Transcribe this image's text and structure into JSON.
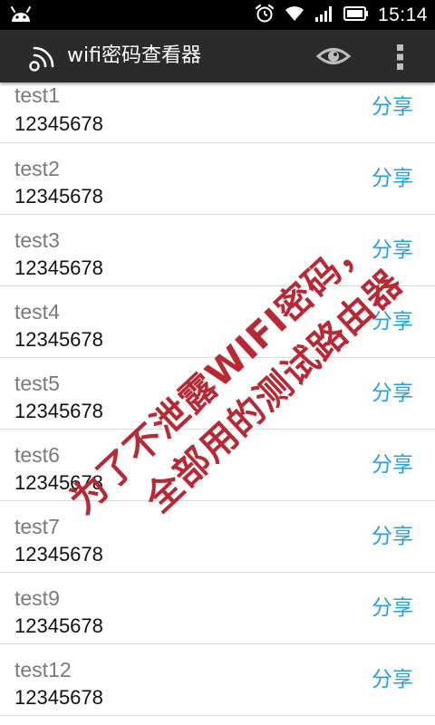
{
  "status_bar": {
    "time": "15:14",
    "icons": [
      "android-icon",
      "alarm-icon",
      "wifi-icon",
      "signal-icon",
      "battery-icon"
    ]
  },
  "action_bar": {
    "title": "wifi密码查看器",
    "icons": [
      "wifi-app-icon",
      "eye-icon",
      "overflow-menu-icon"
    ]
  },
  "list": {
    "share_label": "分享",
    "items": [
      {
        "ssid": "test1",
        "password": "12345678"
      },
      {
        "ssid": "test2",
        "password": "12345678"
      },
      {
        "ssid": "test3",
        "password": "12345678"
      },
      {
        "ssid": "test4",
        "password": "12345678"
      },
      {
        "ssid": "test5",
        "password": "12345678"
      },
      {
        "ssid": "test6",
        "password": "12345678"
      },
      {
        "ssid": "test7",
        "password": "12345678"
      },
      {
        "ssid": "test9",
        "password": "12345678"
      },
      {
        "ssid": "test12",
        "password": "12345678"
      }
    ]
  },
  "watermark": {
    "line1": "为了不泄露WIFI密码，",
    "line2": "全部用的测试路由器"
  },
  "colors": {
    "status_bar_bg": "#000000",
    "action_bar_bg": "#2b2b2b",
    "share_text": "#2a9fd6",
    "watermark": "#b72a35",
    "ssid_text": "#7a7a7a",
    "password_text": "#111111"
  }
}
